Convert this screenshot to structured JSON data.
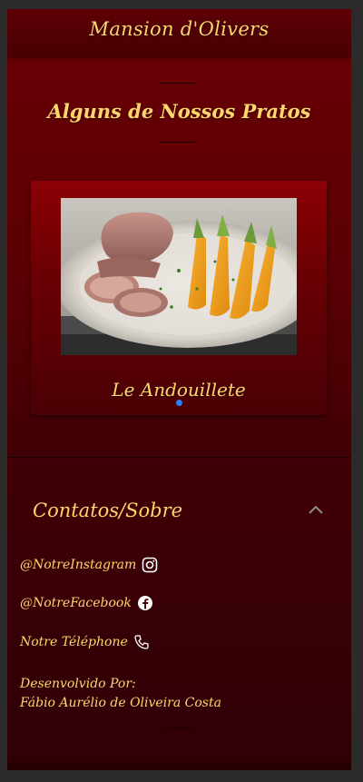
{
  "header": {
    "brand": "Mansion d'Olivers"
  },
  "menu_section": {
    "title": "Alguns de Nossos Pratos"
  },
  "carousel": {
    "slides": [
      {
        "caption": "Le Andouillete",
        "active": true
      }
    ],
    "indicator_color": "#2d7ff9"
  },
  "footer": {
    "title": "Contatos/Sobre",
    "toggle_icon": "chevron-up-icon",
    "contacts": [
      {
        "label": "@NotreInstagram",
        "icon": "instagram-icon"
      },
      {
        "label": "@NotreFacebook",
        "icon": "facebook-icon"
      },
      {
        "label": "Notre Téléphone",
        "icon": "phone-icon"
      }
    ],
    "credits_label": "Desenvolvido Por:",
    "credits_name": "Fábio Aurélio de Oliveira Costa"
  },
  "colors": {
    "accent_text": "#ffd66b",
    "background": "#5a0004",
    "outer": "#2b2b2b"
  }
}
